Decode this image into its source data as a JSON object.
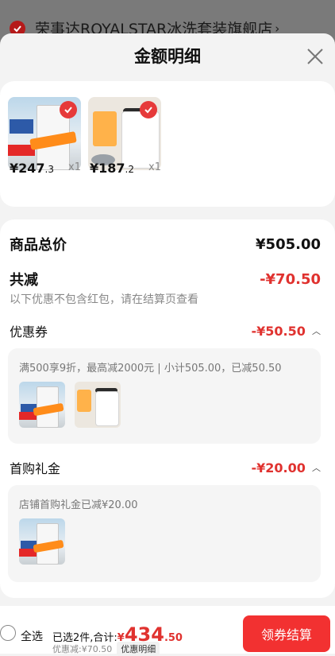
{
  "background": {
    "store_name": "荣事达ROYALSTAR冰洗套装旗舰店",
    "chevron": "›"
  },
  "header": {
    "title": "金额明细"
  },
  "products": [
    {
      "name": "fridge",
      "price_symbol": "¥",
      "price_int": "247",
      "price_dec": ".3",
      "qty": "x1"
    },
    {
      "name": "washer",
      "price_symbol": "¥",
      "price_int": "187",
      "price_dec": ".2",
      "qty": "x1"
    }
  ],
  "summary": {
    "total_label": "商品总价",
    "total_value": "¥505.00",
    "reduce_label": "共减",
    "reduce_value": "-¥70.50",
    "reduce_note": "以下优惠不包含红包，请在结算页查看"
  },
  "coupon": {
    "label": "优惠券",
    "value": "-¥50.50",
    "desc": "满500享9折，最高减2000元 | 小计505.00，已减50.50"
  },
  "gift": {
    "label": "首购礼金",
    "value": "-¥20.00",
    "desc": "店铺首购礼金已减¥20.00"
  },
  "bottom_bar": {
    "select_all": "全选",
    "selected_text": "已选2件,合计:",
    "total_yen": "¥",
    "total_int": "434",
    "total_dec": ".50",
    "discount_text": "优惠减:¥70.50",
    "detail_tag": "优惠明细",
    "checkout_label": "领券结算"
  },
  "colors": {
    "accent": "#e0322f",
    "button": "#f23131"
  }
}
